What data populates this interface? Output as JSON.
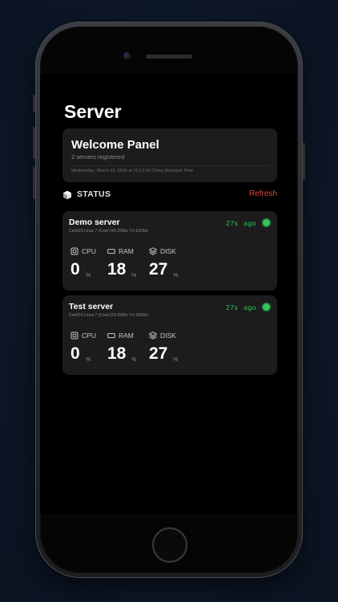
{
  "app": {
    "title": "Server"
  },
  "welcome": {
    "title": "Welcome Panel",
    "subtitle": "2 servers registered",
    "date": "Wednesday, March 20, 2024 at 12:13:42 China Standard Time"
  },
  "status": {
    "label": "STATUS",
    "refresh_label": "Refresh",
    "icon": "cube-icon"
  },
  "colors": {
    "accent_red": "#e0453d",
    "online_green": "#34c759",
    "card_bg": "#1c1c1e"
  },
  "servers": [
    {
      "name": "Demo server",
      "meta": "CentOS Linux 7 (Core) RX:2KB/s TX:11KB/s",
      "time": "27s",
      "ago": "ago",
      "metrics": {
        "cpu": {
          "label": "CPU",
          "value": "0",
          "unit": "%",
          "icon": "cpu-chip-icon"
        },
        "ram": {
          "label": "RAM",
          "value": "18",
          "unit": "%",
          "icon": "memory-icon"
        },
        "disk": {
          "label": "DISK",
          "value": "27",
          "unit": "%",
          "icon": "layers-icon"
        }
      }
    },
    {
      "name": "Test server",
      "meta": "CentOS Linux 7 (Core) RX:2KB/s TX:15KB/s",
      "time": "27s",
      "ago": "ago",
      "metrics": {
        "cpu": {
          "label": "CPU",
          "value": "0",
          "unit": "%",
          "icon": "cpu-chip-icon"
        },
        "ram": {
          "label": "RAM",
          "value": "18",
          "unit": "%",
          "icon": "memory-icon"
        },
        "disk": {
          "label": "DISK",
          "value": "27",
          "unit": "%",
          "icon": "layers-icon"
        }
      }
    }
  ]
}
